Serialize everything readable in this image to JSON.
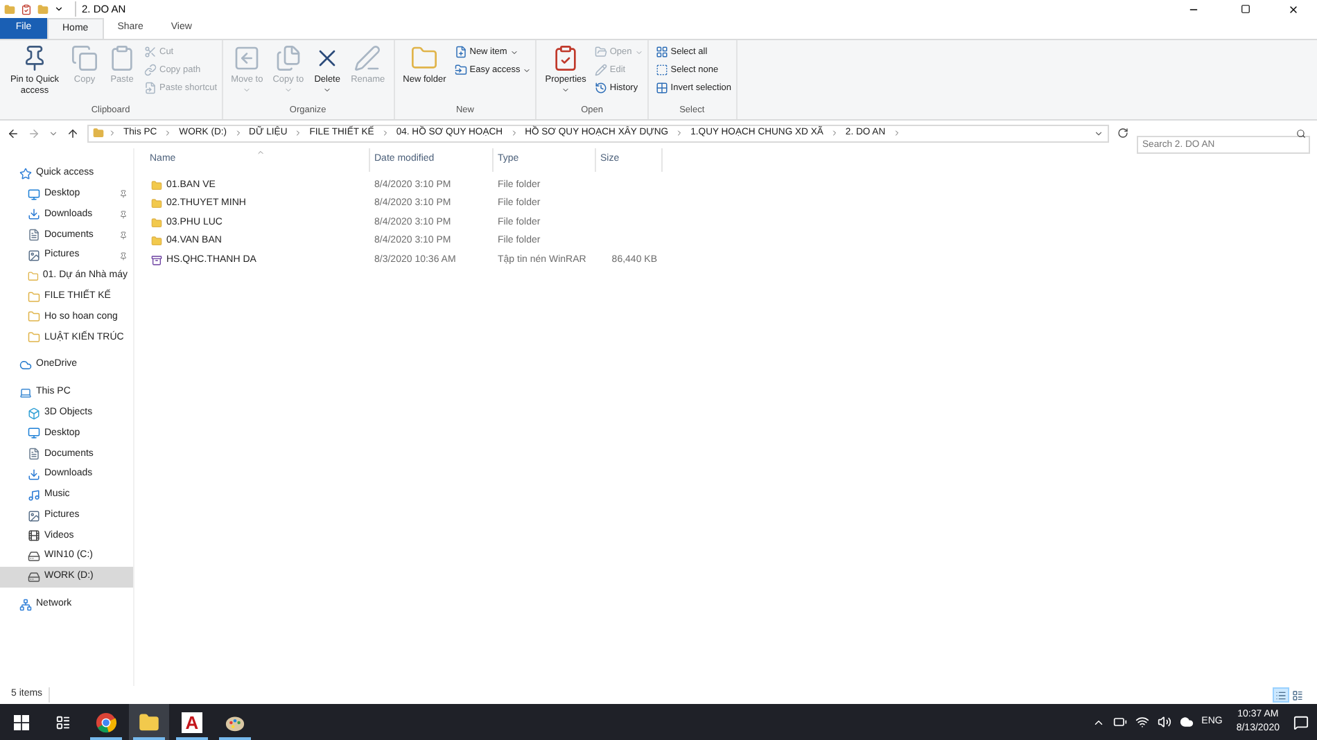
{
  "window": {
    "title": "2. DO AN"
  },
  "file_menu": {
    "label": "File"
  },
  "tabs": [
    {
      "label": "Home",
      "selected": true
    },
    {
      "label": "Share",
      "selected": false
    },
    {
      "label": "View",
      "selected": false
    }
  ],
  "ribbon": [
    {
      "group": "Clipboard",
      "large": [
        {
          "label": "Pin to Quick access",
          "kind": "pin",
          "disabled": false,
          "has_menu": false
        },
        {
          "label": "Copy",
          "kind": "copy",
          "disabled": true,
          "has_menu": false
        },
        {
          "label": "Paste",
          "kind": "paste",
          "disabled": true,
          "has_menu": false
        }
      ],
      "small": [
        {
          "label": "Cut",
          "kind": "cut",
          "disabled": true,
          "has_menu": false
        },
        {
          "label": "Copy path",
          "kind": "path",
          "disabled": true,
          "has_menu": false
        },
        {
          "label": "Paste shortcut",
          "kind": "shortcut",
          "disabled": true,
          "has_menu": false
        }
      ]
    },
    {
      "group": "Organize",
      "large": [
        {
          "label": "Move to",
          "kind": "move",
          "disabled": true,
          "has_menu": true
        },
        {
          "label": "Copy to",
          "kind": "copyto",
          "disabled": true,
          "has_menu": true
        },
        {
          "label": "Delete",
          "kind": "delete",
          "disabled": false,
          "has_menu": true
        },
        {
          "label": "Rename",
          "kind": "rename",
          "disabled": true,
          "has_menu": false
        }
      ]
    },
    {
      "group": "New",
      "large": [
        {
          "label": "New folder",
          "kind": "folder",
          "disabled": false,
          "has_menu": false
        }
      ],
      "small": [
        {
          "label": "New item",
          "kind": "newitem",
          "disabled": false,
          "has_menu": true
        },
        {
          "label": "Easy access",
          "kind": "easy",
          "disabled": false,
          "has_menu": true
        }
      ]
    },
    {
      "group": "Open",
      "large": [
        {
          "label": "Properties",
          "kind": "properties",
          "disabled": false,
          "has_menu": true
        }
      ],
      "small": [
        {
          "label": "Open",
          "kind": "open",
          "disabled": true,
          "has_menu": true
        },
        {
          "label": "Edit",
          "kind": "edit",
          "disabled": true,
          "has_menu": false
        },
        {
          "label": "History",
          "kind": "history",
          "disabled": false,
          "has_menu": false
        }
      ]
    },
    {
      "group": "Select",
      "small": [
        {
          "label": "Select all",
          "kind": "selectall",
          "disabled": false,
          "has_menu": false
        },
        {
          "label": "Select none",
          "kind": "selectnone",
          "disabled": false,
          "has_menu": false
        },
        {
          "label": "Invert selection",
          "kind": "invert",
          "disabled": false,
          "has_menu": false
        }
      ]
    }
  ],
  "address": {
    "path": [
      "This PC",
      "WORK (D:)",
      "DỮ LIỆU",
      "FILE THIẾT KẾ",
      "04. HỒ SƠ QUY HOẠCH",
      "HỒ SƠ QUY HOẠCH XÂY DỰNG",
      "1.QUY HOẠCH CHUNG XD XÃ",
      "2. DO AN"
    ]
  },
  "search": {
    "placeholder": "Search 2. DO AN"
  },
  "sidebar": {
    "items": [
      {
        "label": "Quick access",
        "kind": "star",
        "selected": false,
        "children": [
          {
            "label": "Desktop",
            "kind": "desktop",
            "pinned": true,
            "selected": false
          },
          {
            "label": "Downloads",
            "kind": "download",
            "pinned": true,
            "selected": false
          },
          {
            "label": "Documents",
            "kind": "document",
            "pinned": true,
            "selected": false
          },
          {
            "label": "Pictures",
            "kind": "picture",
            "pinned": true,
            "selected": false
          },
          {
            "label": "01. Dự án Nhà máy",
            "kind": "folder",
            "pinned": false,
            "selected": false
          },
          {
            "label": "FILE THIẾT KẾ",
            "kind": "folder",
            "pinned": false,
            "selected": false
          },
          {
            "label": "Ho so hoan cong",
            "kind": "folder",
            "pinned": false,
            "selected": false
          },
          {
            "label": "LUẬT KIẾN TRÚC",
            "kind": "folder",
            "pinned": false,
            "selected": false
          }
        ]
      },
      {
        "label": "OneDrive",
        "kind": "cloud",
        "selected": false
      },
      {
        "label": "This PC",
        "kind": "pc",
        "selected": false,
        "children": [
          {
            "label": "3D Objects",
            "kind": "cube",
            "pinned": false,
            "selected": false
          },
          {
            "label": "Desktop",
            "kind": "desktop",
            "pinned": false,
            "selected": false
          },
          {
            "label": "Documents",
            "kind": "document",
            "pinned": false,
            "selected": false
          },
          {
            "label": "Downloads",
            "kind": "download",
            "pinned": false,
            "selected": false
          },
          {
            "label": "Music",
            "kind": "music",
            "pinned": false,
            "selected": false
          },
          {
            "label": "Pictures",
            "kind": "picture",
            "pinned": false,
            "selected": false
          },
          {
            "label": "Videos",
            "kind": "video",
            "pinned": false,
            "selected": false
          },
          {
            "label": "WIN10 (C:)",
            "kind": "drive",
            "pinned": false,
            "selected": false
          },
          {
            "label": "WORK (D:)",
            "kind": "drive",
            "pinned": false,
            "selected": true
          }
        ]
      },
      {
        "label": "Network",
        "kind": "network",
        "selected": false
      }
    ]
  },
  "table": {
    "columns": [
      "Name",
      "Date modified",
      "Type",
      "Size"
    ],
    "rows": [
      {
        "name": "01.BAN VE",
        "kind": "folder",
        "date": "8/4/2020 3:10 PM",
        "type": "File folder"
      },
      {
        "name": "02.THUYET MINH",
        "kind": "folder",
        "date": "8/4/2020 3:10 PM",
        "type": "File folder"
      },
      {
        "name": "03.PHU LUC",
        "kind": "folder",
        "date": "8/4/2020 3:10 PM",
        "type": "File folder"
      },
      {
        "name": "04.VAN BAN",
        "kind": "folder",
        "date": "8/4/2020 3:10 PM",
        "type": "File folder"
      },
      {
        "name": "HS.QHC.THANH DA",
        "kind": "archive",
        "date": "8/3/2020 10:36 AM",
        "type": "Tập tin nén WinRAR",
        "size": "86,440 KB"
      }
    ]
  },
  "status_bar": {
    "count": "5 items",
    "views": [
      {
        "kind": "details",
        "selected": true
      },
      {
        "kind": "tiles",
        "selected": false
      }
    ]
  },
  "taskbar": {
    "apps": [
      {
        "kind": "chrome",
        "running": true,
        "selected": false
      },
      {
        "kind": "explorer",
        "running": true,
        "selected": true
      },
      {
        "kind": "autocad",
        "letter": "A",
        "running": true,
        "selected": false
      },
      {
        "kind": "paint",
        "running": true,
        "selected": false
      }
    ],
    "language": "ENG",
    "time": "10:37 AM",
    "date": "8/13/2020"
  }
}
